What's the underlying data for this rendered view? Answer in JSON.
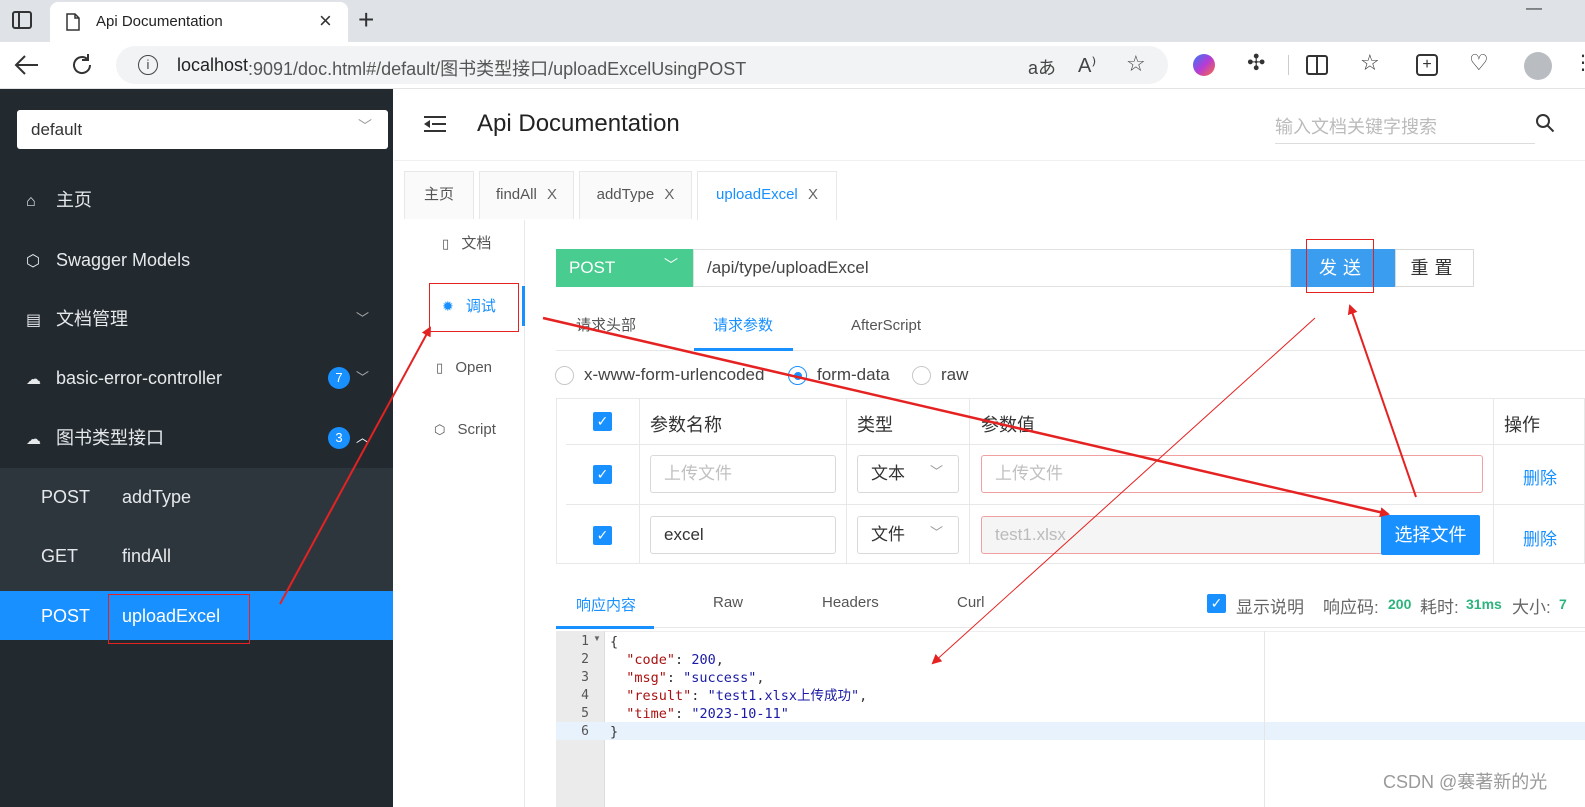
{
  "browser": {
    "tab_title": "Api Documentation",
    "tab_close": "×",
    "new_tab": "+",
    "url_host": "localhost",
    "url_rest": ":9091/doc.html#/default/图书类型接口/uploadExcelUsingPOST",
    "minimize": "—"
  },
  "sidebar": {
    "group_select": "default",
    "items": [
      {
        "label": "主页"
      },
      {
        "label": "Swagger Models"
      },
      {
        "label": "文档管理"
      },
      {
        "label": "basic-error-controller",
        "badge": "7"
      },
      {
        "label": "图书类型接口",
        "badge": "3"
      }
    ],
    "subitems": [
      {
        "method": "POST",
        "name": "addType"
      },
      {
        "method": "GET",
        "name": "findAll"
      },
      {
        "method": "POST",
        "name": "uploadExcel"
      }
    ]
  },
  "header": {
    "title": "Api Documentation",
    "search_placeholder": "输入文档关键字搜索"
  },
  "doc_tabs": [
    {
      "label": "主页"
    },
    {
      "label": "findAll",
      "close": "X"
    },
    {
      "label": "addType",
      "close": "X"
    },
    {
      "label": "uploadExcel",
      "close": "X"
    }
  ],
  "side_tabs": [
    {
      "label": "文档"
    },
    {
      "label": "调试"
    },
    {
      "label": "Open"
    },
    {
      "label": "Script"
    }
  ],
  "request": {
    "method": "POST",
    "url": "/api/type/uploadExcel",
    "send_label": "发送",
    "reset_label": "重置",
    "subtabs": [
      "请求头部",
      "请求参数",
      "AfterScript"
    ],
    "body_types": [
      "x-www-form-urlencoded",
      "form-data",
      "raw"
    ],
    "selected_body_type": "form-data"
  },
  "params_table": {
    "headers": [
      "参数名称",
      "类型",
      "参数值",
      "操作"
    ],
    "rows": [
      {
        "name_placeholder": "上传文件",
        "type": "文本",
        "value_placeholder": "上传文件",
        "action": "删除"
      },
      {
        "name": "excel",
        "type": "文件",
        "value": "test1.xlsx",
        "choose_label": "选择文件",
        "action": "删除"
      }
    ]
  },
  "response": {
    "tabs": [
      "响应内容",
      "Raw",
      "Headers",
      "Curl"
    ],
    "show_desc_label": "显示说明",
    "status_label": "响应码:",
    "status_value": "200",
    "time_label": "耗时:",
    "time_value": "31ms",
    "size_label": "大小:",
    "size_value": "7"
  },
  "code": {
    "line_numbers": [
      "1",
      "2",
      "3",
      "4",
      "5",
      "6"
    ],
    "open_brace": "{",
    "close_brace": "}",
    "lines": [
      {
        "key": "\"code\"",
        "value": "200",
        "trail": ","
      },
      {
        "key": "\"msg\"",
        "value": "\"success\"",
        "trail": ","
      },
      {
        "key": "\"result\"",
        "value": "\"test1.xlsx上传成功\"",
        "trail": ","
      },
      {
        "key": "\"time\"",
        "value": "\"2023-10-11\"",
        "trail": ""
      }
    ]
  },
  "watermark": "CSDN @褰著新的光",
  "colors": {
    "accent": "#1890ff",
    "post_method": "#49cc90",
    "sidebar": "#22292f",
    "annotation": "#e52222"
  }
}
